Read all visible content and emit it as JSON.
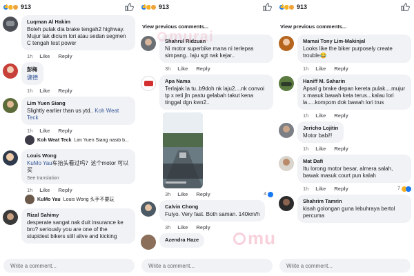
{
  "colors": {
    "accent": "#1877f2",
    "link": "#385898",
    "bubble": "#f0f2f5",
    "meta": "#65676b"
  },
  "reaction_count": "913",
  "panels": [
    {
      "view_previous": "",
      "comments": [
        {
          "author": "Luqman Al Hakim",
          "text": "Boleh pulak dia brake tengah2 highway. Mujur tak dicium lori atau sedan segmen C tengah test power",
          "time": "1h",
          "like": "Like",
          "reply": "Reply"
        },
        {
          "author": "彭梅",
          "text": "健德",
          "time": "1h",
          "like": "Like",
          "reply": "Reply"
        },
        {
          "author": "Lim Yuen Siang",
          "text": "Slightly earlier than us ytd.. ",
          "mention": "Koh Weat Teck",
          "time": "1h",
          "like": "Like",
          "reply": "Reply",
          "reply_preview": {
            "name": "Koh Weat Teck",
            "text": "Lim Yuen Siang nasib b..."
          }
        },
        {
          "author": "Louis Wong",
          "mention": "KuMo Yau",
          "text": "车抬头看过吗？这个motor 可以买",
          "see_translation": "See translation",
          "time": "1h",
          "like": "Like",
          "reply": "Reply",
          "reply_preview": {
            "name": "KuMo Yau",
            "text": "Louis Wong 头手不要玩"
          }
        },
        {
          "author": "Rizal Sahimy",
          "text": "desperate sangat nak duit insurance ke bro? seriously you are one of the stupidest bikers still alive and kicking"
        }
      ]
    },
    {
      "view_previous": "View previous comments...",
      "comments": [
        {
          "author": "Shahrul Ridzuan",
          "text": "Ni motor superbike mana ni terlepas simpang.. laju sgt nak kejar..",
          "time": "3h",
          "like": "Like",
          "reply": "Reply"
        },
        {
          "author": "Apa Nama",
          "text": "Terlajak la tu..b9doh nk laju2....nk convoi tp x reti jln pastu gelabah takut kena tinggal dgn kwn2..",
          "time": "3h",
          "like": "Like",
          "reply": "Reply",
          "reactions": "4"
        },
        {
          "author": "Calvin Chong",
          "text": "Fuiyo. Very fast. Both saman. 140km/h",
          "time": "3h",
          "like": "Like",
          "reply": "Reply"
        },
        {
          "author": "Azendra Haze",
          "text": ""
        }
      ]
    },
    {
      "view_previous": "View previous comments...",
      "comments": [
        {
          "author": "Mamai Tony Lim-Makinjal",
          "text": "Looks like the biker purposely create trouble😂",
          "time": "1h",
          "like": "Like",
          "reply": "Reply"
        },
        {
          "author": "Haniff M. Saharin",
          "text": "Apsal g brake depan kereta pulak....mujur x masuk bawah keta terus...kalau lori la.....kompom dok bawah lori trus",
          "time": "1h",
          "like": "Like",
          "reply": "Reply"
        },
        {
          "author": "Jericho Lojitin",
          "text": "Motor babi!!",
          "time": "1h",
          "like": "Like",
          "reply": "Reply"
        },
        {
          "author": "Mat Dafi",
          "text": "Itu lorong motor besar, almera salah, bawak masuk court pun kalah",
          "time": "1h",
          "like": "Like",
          "reply": "Reply",
          "reactions": "7"
        },
        {
          "author": "Shahrim Tamrin",
          "text": "kisah golongan guna lebuhraya bertol percuma"
        }
      ]
    }
  ],
  "input_placeholder": "Write a comment...",
  "watermark": "murai"
}
